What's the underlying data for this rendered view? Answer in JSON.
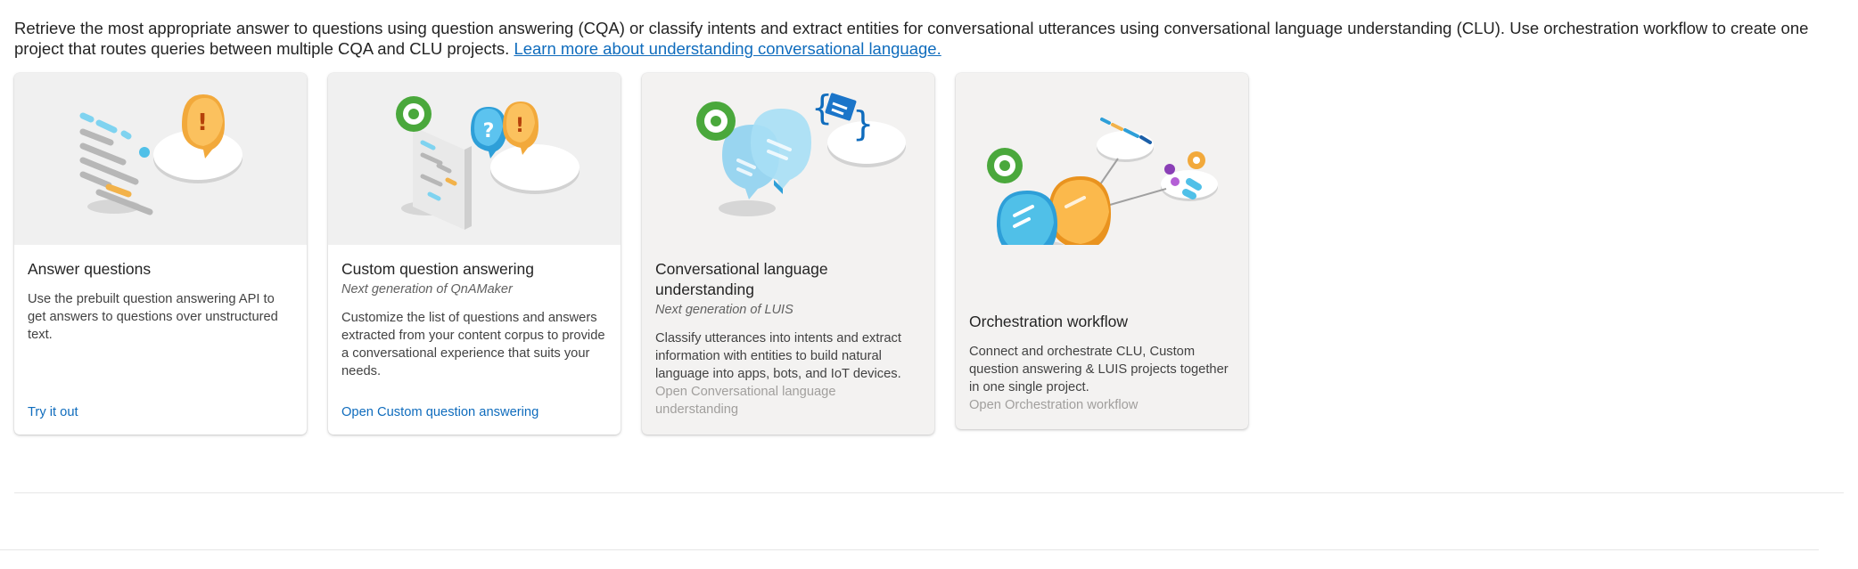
{
  "intro": {
    "text": "Retrieve the most appropriate answer to questions using question answering (CQA) or classify intents and extract entities for conversational utterances using conversational language understanding (CLU). Use orchestration workflow to create one project that routes queries between multiple CQA and CLU projects.",
    "link": "Learn more about understanding conversational language."
  },
  "cards": [
    {
      "title": "Answer questions",
      "subtitle": "",
      "description": "Use the prebuilt question answering API to get answers to questions over unstructured text.",
      "action": "Try it out",
      "illustration": "answer-questions-illustration"
    },
    {
      "title": "Custom question answering",
      "subtitle": "Next generation of QnAMaker",
      "description": "Customize the list of questions and answers extracted from your content corpus to provide a conversational experience that suits your needs.",
      "action": "Open Custom question answering",
      "illustration": "custom-qa-illustration"
    },
    {
      "title": "Conversational language understanding",
      "subtitle": "Next generation of LUIS",
      "description": "Classify utterances into intents and extract information with entities to build natural language into apps, bots, and IoT devices.",
      "action": "Open Conversational language understanding",
      "illustration": "clu-illustration"
    },
    {
      "title": "Orchestration workflow",
      "subtitle": "",
      "description": "Connect and orchestrate CLU, Custom question answering & LUIS projects together in one single project.",
      "action": "Open Orchestration workflow",
      "illustration": "orchestration-illustration"
    }
  ],
  "colors": {
    "link": "#0f6cbd",
    "disabled_text": "#a19f9d",
    "card_disabled_bg": "#f3f2f1"
  }
}
